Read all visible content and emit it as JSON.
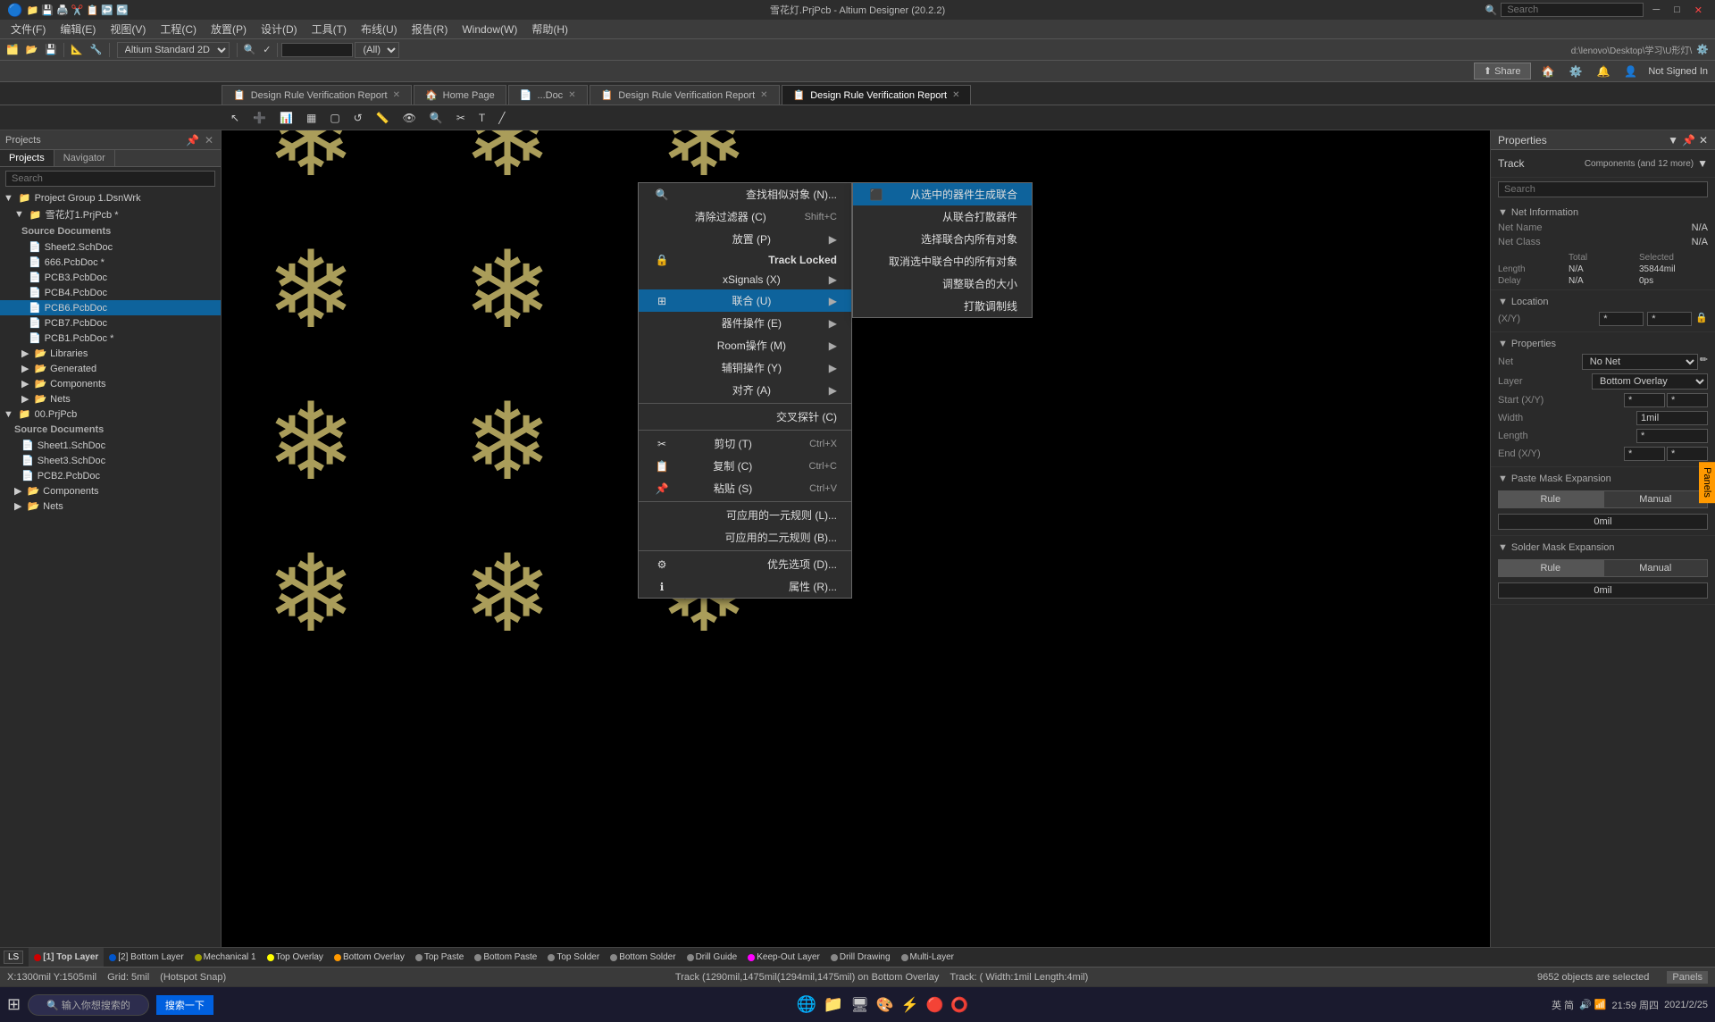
{
  "titlebar": {
    "title": "雪花灯.PrjPcb - Altium Designer (20.2.2)",
    "search_placeholder": "Search",
    "min": "─",
    "max": "□",
    "close": "✕"
  },
  "toolbar": {
    "items": [
      "文件(F)",
      "编辑(E)",
      "视图(V)",
      "工程(C)",
      "放置(P)",
      "设计(D)",
      "工具(T)",
      "布线(U)",
      "报告(R)",
      "帮助(H)"
    ]
  },
  "tabs": [
    {
      "label": "Design Rule Verification Report",
      "icon": "📋",
      "active": false,
      "closeable": true
    },
    {
      "label": "Home Page",
      "icon": "🏠",
      "active": false,
      "closeable": false
    },
    {
      "label": "...Doc",
      "icon": "📄",
      "active": false,
      "closeable": true
    },
    {
      "label": "Design Rule Verification Report",
      "icon": "📋",
      "active": false,
      "closeable": true
    },
    {
      "label": "Design Rule Verification Report",
      "icon": "📋",
      "active": true,
      "closeable": true
    }
  ],
  "main_dropdown": {
    "standard": "Altium Standard 2D",
    "all": "(All)"
  },
  "projects_panel": {
    "title": "Projects",
    "tabs": [
      "Projects",
      "Navigator"
    ],
    "search_placeholder": "Search",
    "tree": [
      {
        "level": 0,
        "label": "Project Group 1.DsnWrk",
        "type": "group",
        "icon": "📁"
      },
      {
        "level": 1,
        "label": "雪花灯1.PrjPcb *",
        "type": "project",
        "icon": "📁",
        "selected": true
      },
      {
        "level": 2,
        "label": "Source Documents",
        "type": "folder",
        "icon": "📂"
      },
      {
        "level": 3,
        "label": "Sheet2.SchDoc",
        "type": "file",
        "icon": "📄"
      },
      {
        "level": 3,
        "label": "666.PcbDoc *",
        "type": "file",
        "icon": "📄"
      },
      {
        "level": 3,
        "label": "PCB3.PcbDoc",
        "type": "file",
        "icon": "📄"
      },
      {
        "level": 3,
        "label": "PCB4.PcbDoc",
        "type": "file",
        "icon": "📄"
      },
      {
        "level": 3,
        "label": "PCB6.PcbDoc",
        "type": "file",
        "icon": "📄",
        "active": true
      },
      {
        "level": 3,
        "label": "PCB7.PcbDoc",
        "type": "file",
        "icon": "📄"
      },
      {
        "level": 3,
        "label": "PCB1.PcbDoc *",
        "type": "file",
        "icon": "📄"
      },
      {
        "level": 2,
        "label": "Libraries",
        "type": "folder",
        "icon": "📂"
      },
      {
        "level": 2,
        "label": "Generated",
        "type": "folder",
        "icon": "📂"
      },
      {
        "level": 2,
        "label": "Components",
        "type": "folder",
        "icon": "📂"
      },
      {
        "level": 2,
        "label": "Nets",
        "type": "folder",
        "icon": "📂"
      },
      {
        "level": 0,
        "label": "00.PrjPcb",
        "type": "project",
        "icon": "📁"
      },
      {
        "level": 1,
        "label": "Source Documents",
        "type": "folder",
        "icon": "📂"
      },
      {
        "level": 2,
        "label": "Sheet1.SchDoc",
        "type": "file",
        "icon": "📄"
      },
      {
        "level": 2,
        "label": "Sheet3.SchDoc",
        "type": "file",
        "icon": "📄"
      },
      {
        "level": 2,
        "label": "PCB2.PcbDoc",
        "type": "file",
        "icon": "📄"
      },
      {
        "level": 1,
        "label": "Components",
        "type": "folder",
        "icon": "📂"
      },
      {
        "level": 1,
        "label": "Nets",
        "type": "folder",
        "icon": "📂"
      }
    ]
  },
  "context_menu": {
    "items": [
      {
        "label": "查找相似对象 (N)...",
        "shortcut": "",
        "has_sub": false,
        "separator_after": false
      },
      {
        "label": "清除过滤器 (C)",
        "shortcut": "Shift+C",
        "has_sub": false,
        "separator_after": false
      },
      {
        "label": "放置 (P)",
        "shortcut": "",
        "has_sub": true,
        "separator_after": false
      },
      {
        "label": "Track Locked",
        "shortcut": "",
        "has_sub": false,
        "separator_after": false
      },
      {
        "label": "xSignals (X)",
        "shortcut": "",
        "has_sub": true,
        "separator_after": false
      },
      {
        "label": "联合 (U)",
        "shortcut": "",
        "has_sub": true,
        "separator_after": false,
        "highlighted": true
      },
      {
        "label": "器件操作 (E)",
        "shortcut": "",
        "has_sub": true,
        "separator_after": false
      },
      {
        "label": "Room操作 (M)",
        "shortcut": "",
        "has_sub": true,
        "separator_after": false
      },
      {
        "label": "辅铜操作 (Y)",
        "shortcut": "",
        "has_sub": true,
        "separator_after": false
      },
      {
        "label": "对齐 (A)",
        "shortcut": "",
        "has_sub": true,
        "separator_after": false
      },
      {
        "separator": true
      },
      {
        "label": "交叉探针 (C)",
        "shortcut": "",
        "has_sub": false,
        "separator_after": false
      },
      {
        "separator": true
      },
      {
        "label": "剪切 (T)",
        "shortcut": "Ctrl+X",
        "has_sub": false,
        "separator_after": false
      },
      {
        "label": "复制 (C)",
        "shortcut": "Ctrl+C",
        "has_sub": false,
        "separator_after": false
      },
      {
        "label": "粘贴 (S)",
        "shortcut": "Ctrl+V",
        "has_sub": false,
        "separator_after": false
      },
      {
        "separator": true
      },
      {
        "label": "可应用的一元规则 (L)...",
        "shortcut": "",
        "has_sub": false,
        "separator_after": false
      },
      {
        "label": "可应用的二元规则 (B)...",
        "shortcut": "",
        "has_sub": false,
        "separator_after": false
      },
      {
        "separator": true
      },
      {
        "label": "优先选项 (D)...",
        "shortcut": "",
        "has_sub": false,
        "separator_after": false
      },
      {
        "label": "属性 (R)...",
        "shortcut": "",
        "has_sub": false,
        "separator_after": false
      }
    ]
  },
  "sub_menu": {
    "items": [
      {
        "label": "从选中的器件生成联合",
        "icon": "⬛",
        "highlighted": true
      },
      {
        "label": "从联合打散器件",
        "icon": ""
      },
      {
        "label": "选择联合内所有对象",
        "icon": ""
      },
      {
        "label": "取消选中联合中的所有对象",
        "icon": ""
      },
      {
        "label": "调整联合的大小",
        "icon": ""
      },
      {
        "label": "打散调制线",
        "icon": ""
      }
    ]
  },
  "properties_panel": {
    "title": "Properties",
    "track_label": "Track",
    "track_value": "Components (and 12 more)",
    "search_placeholder": "Search",
    "net_info": {
      "section": "Net Information",
      "net_name_label": "Net Name",
      "net_name_value": "N/A",
      "net_class_label": "Net Class",
      "net_class_value": "N/A"
    },
    "totals": {
      "total_label": "Total",
      "selected_label": "Selected",
      "length_label": "Length",
      "length_total": "N/A",
      "length_selected": "35844mil",
      "delay_label": "Delay",
      "delay_total": "N/A",
      "delay_selected": "0ps"
    },
    "location": {
      "section": "Location",
      "xy_label": "(X/Y)",
      "x_val": "*",
      "y_val": "*"
    },
    "props": {
      "section": "Properties",
      "net_label": "Net",
      "net_value": "No Net",
      "layer_label": "Layer",
      "layer_value": "Bottom Overlay",
      "start_label": "Start (X/Y)",
      "start_x": "*",
      "start_y": "*",
      "width_label": "Width",
      "width_value": "1mil",
      "length_label": "Length",
      "length_value": "*",
      "end_label": "End (X/Y)",
      "end_x": "*",
      "end_y": "*"
    },
    "paste_mask": {
      "section": "Paste Mask Expansion",
      "rule_btn": "Rule",
      "manual_btn": "Manual",
      "value": "0mil"
    },
    "solder_mask": {
      "section": "Solder Mask Expansion",
      "rule_btn": "Rule",
      "manual_btn": "Manual",
      "value": "0mil"
    }
  },
  "share_bar": {
    "share_label": "Share",
    "not_signed": "Not Signed In"
  },
  "layers": [
    {
      "label": "[1] Top Layer",
      "color": "#cc0000"
    },
    {
      "label": "[2] Bottom Layer",
      "color": "#0055cc"
    },
    {
      "label": "Mechanical 1",
      "color": "#a0a000"
    },
    {
      "label": "Top Overlay",
      "color": "#ffff00"
    },
    {
      "label": "Bottom Overlay",
      "color": "#ff9900"
    },
    {
      "label": "Top Paste",
      "color": "#888888"
    },
    {
      "label": "Bottom Paste",
      "color": "#888888"
    },
    {
      "label": "Top Solder",
      "color": "#888888"
    },
    {
      "label": "Bottom Solder",
      "color": "#888888"
    },
    {
      "label": "Drill Guide",
      "color": "#888888"
    },
    {
      "label": "Keep-Out Layer",
      "color": "#ff00ff"
    },
    {
      "label": "Drill Drawing",
      "color": "#888888"
    },
    {
      "label": "Multi-Layer",
      "color": "#888888"
    }
  ],
  "statusbar": {
    "coords": "X:1300mil Y:1505mil",
    "grid": "Grid: 5mil",
    "hotspot": "(Hotspot Snap)",
    "track_info": "Track (1290mil,1475mil(1294mil,1475mil) on Bottom Overlay",
    "track_props": "Track: ( Width:1mil Length:4mil)",
    "objects_selected": "9652 objects are selected"
  },
  "taskbar": {
    "time": "21:59 周四",
    "date": "2021/2/25"
  }
}
